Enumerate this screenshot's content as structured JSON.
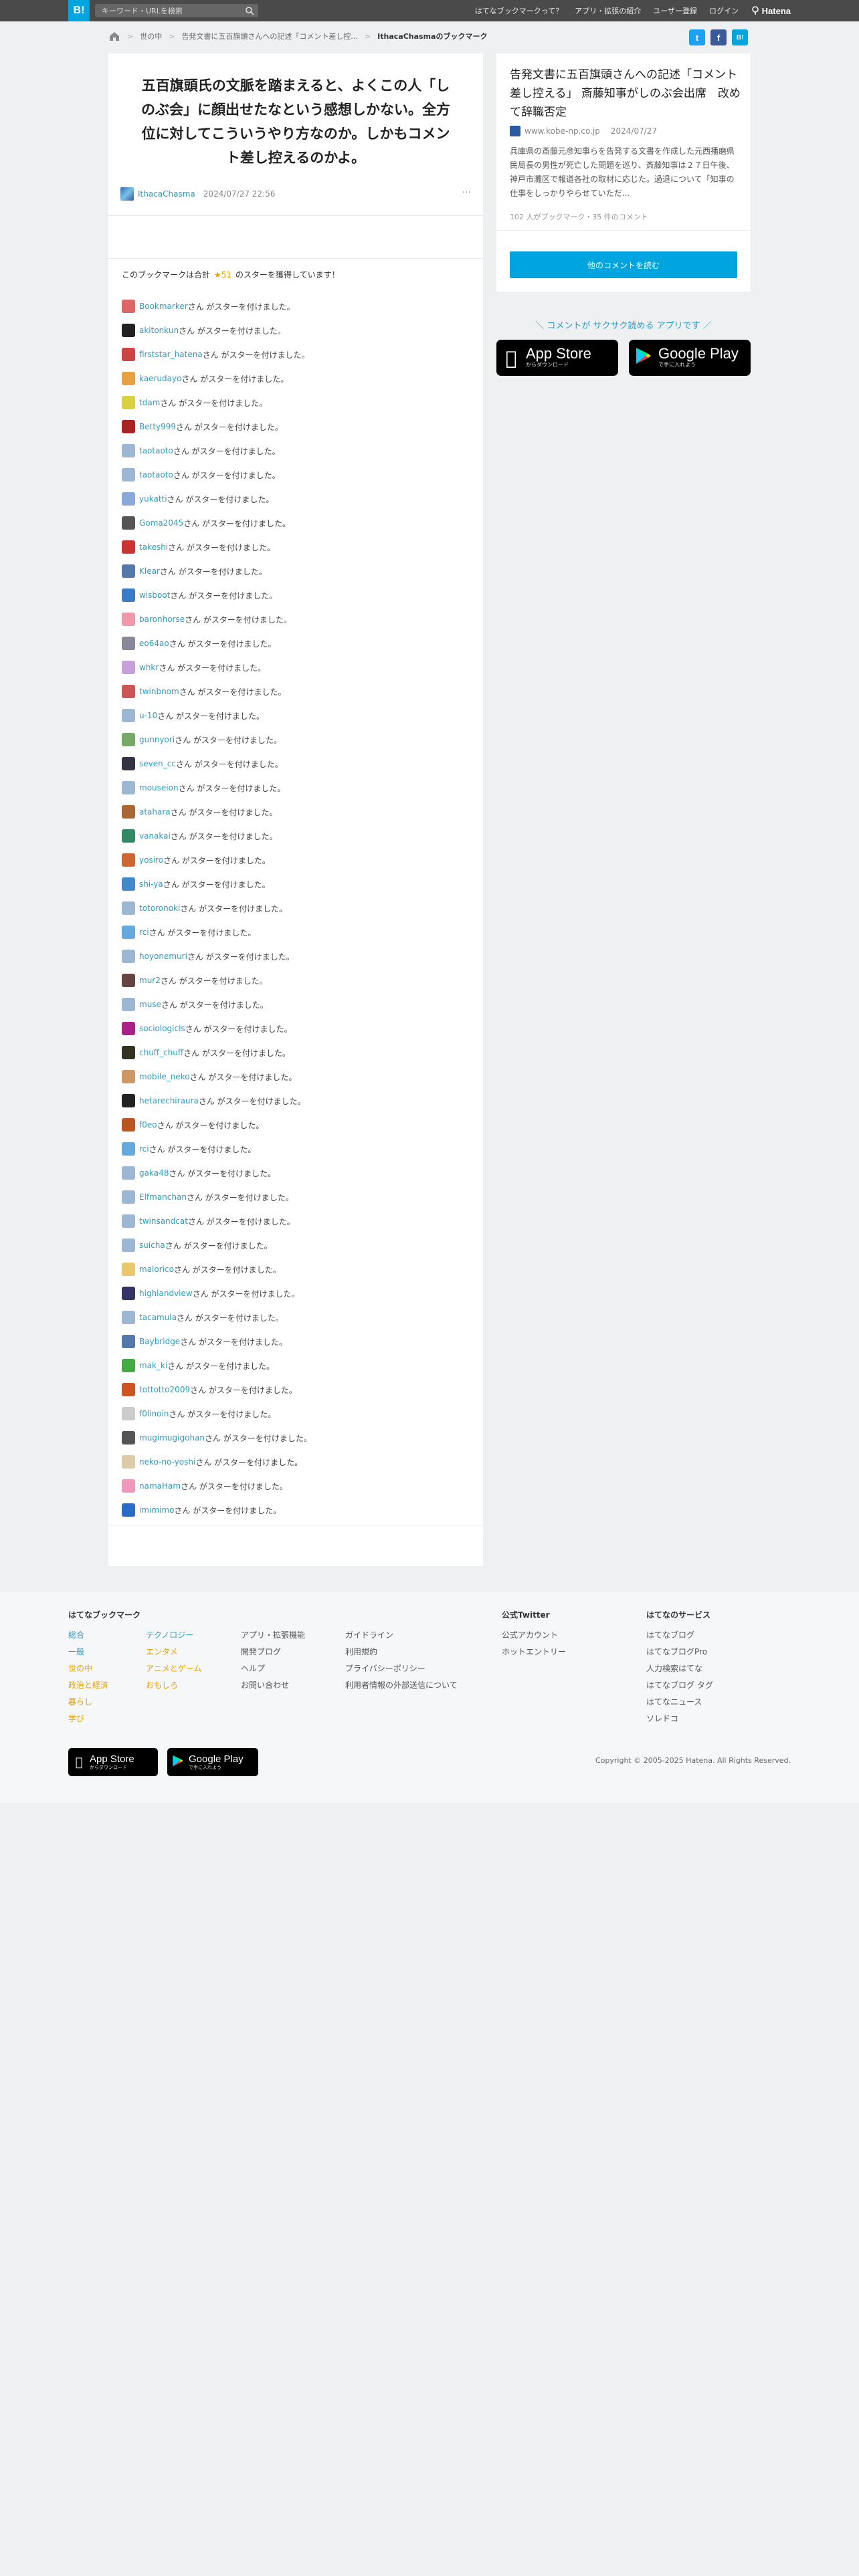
{
  "topbar": {
    "logo": "B!",
    "search_placeholder": "キーワード・URLを検索",
    "nav": [
      "はてなブックマークって？",
      "アプリ・拡張の紹介",
      "ユーザー登録",
      "ログイン"
    ],
    "brand": "Hatena"
  },
  "breadcrumb": {
    "items": [
      "世の中",
      "告発文書に五百旗頭さんへの記述「コメント差し控..."
    ],
    "current": "IthacaChasmaのブックマーク"
  },
  "share": {
    "twitter": "t",
    "facebook": "f",
    "hatena": "B!"
  },
  "bookmark": {
    "comment": "五百旗頭氏の文脈を踏まえると、よくこの人「しのぶ会」に顔出せたなという感想しかない。全方位に対してこういうやり方なのか。しかもコメント差し控えるのかよ。",
    "user": "IthacaChasma",
    "date": "2024/07/27 22:56",
    "menu": "···"
  },
  "stars": {
    "summary_prefix": "このブックマークは合計",
    "count": "★51",
    "summary_suffix": "のスターを獲得しています！",
    "suffix": "さん がスターを付けました。",
    "users": [
      {
        "name": "Bookmarker",
        "color": "#d66"
      },
      {
        "name": "akitonkun",
        "color": "#222"
      },
      {
        "name": "firststar_hatena",
        "color": "#c44"
      },
      {
        "name": "kaerudayo",
        "color": "#e9a040"
      },
      {
        "name": "tdam",
        "color": "#d8d040"
      },
      {
        "name": "Betty999",
        "color": "#a22"
      },
      {
        "name": "taotaoto",
        "color": "#9bb7d4"
      },
      {
        "name": "taotaoto",
        "color": "#9bb7d4"
      },
      {
        "name": "yukatti",
        "color": "#8aa8d8"
      },
      {
        "name": "Goma2045",
        "color": "#555"
      },
      {
        "name": "takeshi",
        "color": "#c33"
      },
      {
        "name": "Klear",
        "color": "#57a"
      },
      {
        "name": "wisboot",
        "color": "#3a7bc8"
      },
      {
        "name": "baronhorse",
        "color": "#e9a"
      },
      {
        "name": "eo64ao",
        "color": "#889"
      },
      {
        "name": "whkr",
        "color": "#c6a0d8"
      },
      {
        "name": "twinbnom",
        "color": "#c55"
      },
      {
        "name": "u-10",
        "color": "#9bb7d4"
      },
      {
        "name": "gunnyori",
        "color": "#7a6"
      },
      {
        "name": "seven_cc",
        "color": "#334"
      },
      {
        "name": "mouseion",
        "color": "#9bb7d4"
      },
      {
        "name": "atahara",
        "color": "#a63"
      },
      {
        "name": "vanakai",
        "color": "#386"
      },
      {
        "name": "yosiro",
        "color": "#c63"
      },
      {
        "name": "shi-ya",
        "color": "#48c"
      },
      {
        "name": "totoronoki",
        "color": "#9bb7d4"
      },
      {
        "name": "rci",
        "color": "#6ad"
      },
      {
        "name": "hoyonemuri",
        "color": "#9bb7d4"
      },
      {
        "name": "mur2",
        "color": "#644"
      },
      {
        "name": "muse",
        "color": "#9bb7d4"
      },
      {
        "name": "sociologicls",
        "color": "#a28"
      },
      {
        "name": "chuff_chuff",
        "color": "#332"
      },
      {
        "name": "mobile_neko",
        "color": "#c96"
      },
      {
        "name": "hetarechiraura",
        "color": "#222"
      },
      {
        "name": "f0eo",
        "color": "#b52"
      },
      {
        "name": "rci",
        "color": "#6ad"
      },
      {
        "name": "gaka48",
        "color": "#9bb7d4"
      },
      {
        "name": "Elfmanchan",
        "color": "#9bb7d4"
      },
      {
        "name": "twinsandcat",
        "color": "#9bb7d4"
      },
      {
        "name": "suicha",
        "color": "#9bb7d4"
      },
      {
        "name": "malorico",
        "color": "#e8c86a"
      },
      {
        "name": "highlandview",
        "color": "#336"
      },
      {
        "name": "tacamula",
        "color": "#9bb7d4"
      },
      {
        "name": "Baybridge",
        "color": "#57a"
      },
      {
        "name": "mak_ki",
        "color": "#4a4"
      },
      {
        "name": "tottotto2009",
        "color": "#c52"
      },
      {
        "name": "f0linoin",
        "color": "#ccc"
      },
      {
        "name": "mugimugigohan",
        "color": "#555"
      },
      {
        "name": "neko-no-yoshi",
        "color": "#dca"
      },
      {
        "name": "namaHam",
        "color": "#e9b"
      },
      {
        "name": "imimimo",
        "color": "#2a6bc8"
      }
    ]
  },
  "entry": {
    "title": "告発文書に五百旗頭さんへの記述「コメント差し控える」 斎藤知事がしのぶ会出席　改めて辞職否定",
    "source": "www.kobe-np.co.jp",
    "date": "2024/07/27",
    "description": "兵庫県の斎藤元彦知事らを告発する文書を作成した元西播磨県民局長の男性が死亡した問題を巡り、斎藤知事は２７日午後、神戸市灘区で報道各社の取材に応じた。過退について「知事の仕事をしっかりやらせていただ...",
    "count": "102 人がブックマーク・35 件のコメント",
    "button": "他のコメントを読む"
  },
  "promo": {
    "text": "＼ コメントが サクサク読める アプリです ／",
    "appstore_big": "App Store",
    "appstore_small": "からダウンロード",
    "googleplay_big": "Google Play",
    "googleplay_small": "で手に入れよう"
  },
  "footer": {
    "col1_title": "はてなブックマーク",
    "col1a": [
      "総合",
      "一般",
      "世の中",
      "政治と経済",
      "暮らし",
      "学び"
    ],
    "col1b": [
      "テクノロジー",
      "エンタメ",
      "アニメとゲーム",
      "おもしろ"
    ],
    "col1c": [
      "アプリ・拡張機能",
      "開発ブログ",
      "ヘルプ",
      "お問い合わせ"
    ],
    "col1d": [
      "ガイドライン",
      "利用規約",
      "プライバシーポリシー",
      "利用者情報の外部送信について"
    ],
    "col2_title": "公式Twitter",
    "col2": [
      "公式アカウント",
      "ホットエントリー"
    ],
    "col3_title": "はてなのサービス",
    "col3": [
      "はてなブログ",
      "はてなブログPro",
      "人力検索はてな",
      "はてなブログ タグ",
      "はてなニュース",
      "ソレドコ"
    ],
    "copyright": "Copyright © 2005-2025 Hatena. All Rights Reserved."
  }
}
